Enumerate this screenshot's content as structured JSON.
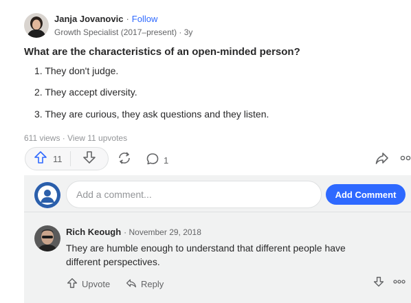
{
  "colors": {
    "accent": "#2e69ff",
    "text": "#282829",
    "muted": "#636466",
    "comment_bg": "#f1f2f2"
  },
  "author": {
    "name": "Janja Jovanovic",
    "separator": "·",
    "follow_label": "Follow",
    "credential": "Growth Specialist (2017–present) · 3y"
  },
  "question": "What are the characteristics of an open-minded person?",
  "answer": {
    "items": [
      "1. They don't judge.",
      "2. They accept diversity.",
      "3. They are curious, they ask questions and they listen."
    ]
  },
  "stats": "611 views · View 11 upvotes",
  "actions": {
    "upvote_count": "11",
    "comment_count": "1"
  },
  "comment_box": {
    "placeholder": "Add a comment...",
    "button_label": "Add Comment"
  },
  "comment": {
    "author": "Rich Keough",
    "date": "· November 29, 2018",
    "text_line1": "They are humble enough to understand that different people have",
    "text_line2": "different perspectives.",
    "upvote_label": "Upvote",
    "reply_label": "Reply"
  },
  "icons": [
    "upvote-icon",
    "downvote-icon",
    "share-rotate-icon",
    "comment-bubble-icon",
    "share-arrow-icon",
    "more-icon",
    "reply-icon"
  ]
}
